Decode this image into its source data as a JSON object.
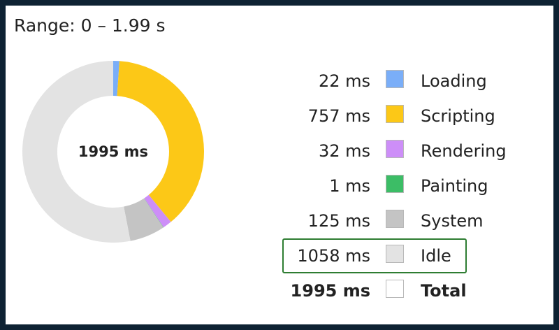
{
  "summary": {
    "range_label": "Range: 0 – 1.99 s",
    "total_label": "1995 ms"
  },
  "chart_data": {
    "type": "pie",
    "unit": "ms",
    "total": 1995,
    "categories": [
      "Loading",
      "Scripting",
      "Rendering",
      "Painting",
      "System",
      "Idle"
    ],
    "values": [
      22,
      757,
      32,
      1,
      125,
      1058
    ],
    "colors": [
      "#7aaef8",
      "#fcc817",
      "#cd8ef8",
      "#3cbd66",
      "#c4c4c4",
      "#e3e3e3"
    ]
  },
  "legend": {
    "rows": [
      {
        "value": "22 ms",
        "label": "Loading",
        "color": "#7aaef8"
      },
      {
        "value": "757 ms",
        "label": "Scripting",
        "color": "#fcc817"
      },
      {
        "value": "32 ms",
        "label": "Rendering",
        "color": "#cd8ef8"
      },
      {
        "value": "1 ms",
        "label": "Painting",
        "color": "#3cbd66"
      },
      {
        "value": "125 ms",
        "label": "System",
        "color": "#c4c4c4"
      },
      {
        "value": "1058 ms",
        "label": "Idle",
        "color": "#e3e3e3"
      },
      {
        "value": "1995 ms",
        "label": "Total",
        "color": "#ffffff"
      }
    ],
    "highlighted_row": "Idle",
    "highlight_color": "#2e7d32"
  }
}
